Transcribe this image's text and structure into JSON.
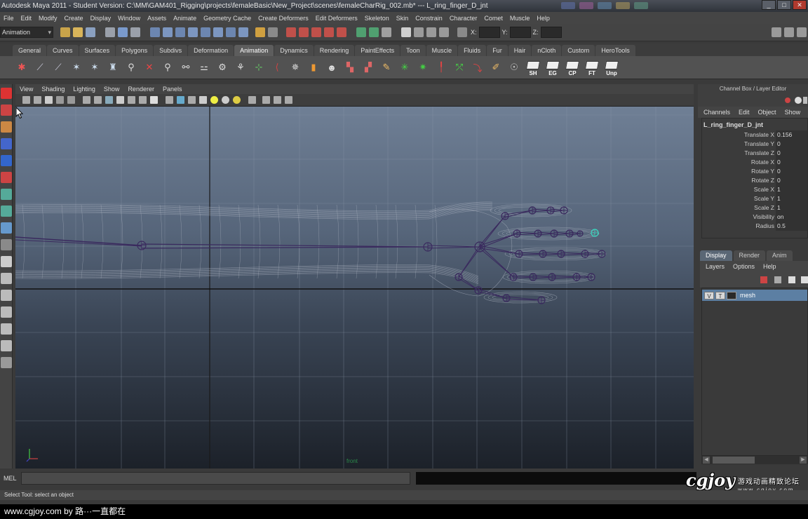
{
  "title_bar": {
    "title": "Autodesk Maya 2011 - Student Version: C:\\MM\\GAM401_Rigging\\projects\\femaleBasic\\New_Project\\scenes\\femaleCharRig_002.mb*  ---  L_ring_finger_D_jnt",
    "minimize": "_",
    "maximize": "□",
    "close": "✕"
  },
  "menu_bar": [
    "File",
    "Edit",
    "Modify",
    "Create",
    "Display",
    "Window",
    "Assets",
    "Animate",
    "Geometry Cache",
    "Create Deformers",
    "Edit Deformers",
    "Skeleton",
    "Skin",
    "Constrain",
    "Character",
    "Comet",
    "Muscle",
    "Help"
  ],
  "status_line": {
    "mode": "Animation",
    "x_label": "X:",
    "y_label": "Y:",
    "z_label": "Z:"
  },
  "shelf_tabs": [
    "General",
    "Curves",
    "Surfaces",
    "Polygons",
    "Subdivs",
    "Deformation",
    "Animation",
    "Dynamics",
    "Rendering",
    "PaintEffects",
    "Toon",
    "Muscle",
    "Fluids",
    "Fur",
    "Hair",
    "nCloth",
    "Custom",
    "HeroTools"
  ],
  "shelf_active_tab": "Animation",
  "shelf_text_buttons": [
    "SH",
    "EG",
    "CP",
    "FT",
    "Unp"
  ],
  "viewport_menu": [
    "View",
    "Shading",
    "Lighting",
    "Show",
    "Renderer",
    "Panels"
  ],
  "viewport_label": "front",
  "channel_box": {
    "header": "Channel Box / Layer Editor",
    "menu": [
      "Channels",
      "Edit",
      "Object",
      "Show"
    ],
    "object_name": "L_ring_finger_D_jnt",
    "attributes": [
      {
        "name": "Translate X",
        "value": "0.156"
      },
      {
        "name": "Translate Y",
        "value": "0"
      },
      {
        "name": "Translate Z",
        "value": "0"
      },
      {
        "name": "Rotate X",
        "value": "0"
      },
      {
        "name": "Rotate Y",
        "value": "0"
      },
      {
        "name": "Rotate Z",
        "value": "0"
      },
      {
        "name": "Scale X",
        "value": "1"
      },
      {
        "name": "Scale Y",
        "value": "1"
      },
      {
        "name": "Scale Z",
        "value": "1"
      },
      {
        "name": "Visibility",
        "value": "on"
      },
      {
        "name": "Radius",
        "value": "0.5"
      }
    ]
  },
  "layer_editor": {
    "tabs": [
      "Display",
      "Render",
      "Anim"
    ],
    "active_tab": "Display",
    "menu": [
      "Layers",
      "Options",
      "Help"
    ],
    "layers": [
      {
        "v": "V",
        "t": "T",
        "name": "mesh"
      }
    ]
  },
  "command_line": {
    "label": "MEL"
  },
  "help_line": "Select Tool: select an object",
  "watermark": {
    "logo": "cgjoy",
    "text_cn": "游戏动画精致论坛",
    "url": "www.cgjoy.com"
  },
  "footer": "www.cgjoy.com by 路···一直都在",
  "colors": {
    "joint": "#3a2a5e",
    "wire": "#b9c0cc",
    "selected_joint": "#3ad9c0",
    "active_tab": "#5d5d5d",
    "layer_highlight": "#5c7fa3"
  }
}
